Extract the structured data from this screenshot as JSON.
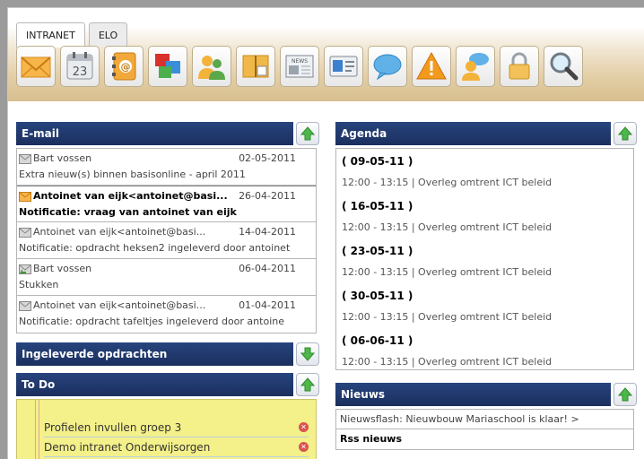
{
  "tabs": [
    {
      "label": "INTRANET",
      "active": true
    },
    {
      "label": "ELO",
      "active": false
    }
  ],
  "toolbar": [
    {
      "icon": "envelope-icon"
    },
    {
      "icon": "calendar-icon",
      "text": "23"
    },
    {
      "icon": "address-book-icon"
    },
    {
      "icon": "windows-icon"
    },
    {
      "icon": "users-icon"
    },
    {
      "icon": "book-icon"
    },
    {
      "icon": "news-icon",
      "text": "NEWS"
    },
    {
      "icon": "id-card-icon"
    },
    {
      "icon": "chat-icon"
    },
    {
      "icon": "warning-icon"
    },
    {
      "icon": "user-chat-icon"
    },
    {
      "icon": "lock-icon"
    },
    {
      "icon": "search-icon"
    }
  ],
  "email": {
    "title": "E-mail",
    "items": [
      {
        "from": "Bart vossen",
        "date": "02-05-2011",
        "subject": "Extra nieuw(s) binnen basisonline - april 2011",
        "unread": false,
        "icon": "read-mail-icon"
      },
      {
        "from": "Antoinet van eijk<antoinet@basi...",
        "date": "26-04-2011",
        "subject": "Notificatie: vraag van antoinet van eijk",
        "unread": true,
        "icon": "unread-mail-icon"
      },
      {
        "from": "Antoinet van eijk<antoinet@basi...",
        "date": "14-04-2011",
        "subject": "Notificatie: opdracht heksen2 ingeleverd door antoinet",
        "unread": false,
        "icon": "read-mail-icon"
      },
      {
        "from": "Bart vossen",
        "date": "06-04-2011",
        "subject": "Stukken",
        "unread": false,
        "icon": "replied-mail-icon"
      },
      {
        "from": "Antoinet van eijk<antoinet@basi...",
        "date": "01-04-2011",
        "subject": "Notificatie: opdracht tafeltjes ingeleverd door antoine",
        "unread": false,
        "icon": "read-mail-icon"
      }
    ]
  },
  "ingeleverd": {
    "title": "Ingeleverde opdrachten"
  },
  "todo": {
    "title": "To Do",
    "items": [
      "Profielen invullen groep 3",
      "Demo intranet Onderwijsorgen"
    ]
  },
  "agenda": {
    "title": "Agenda",
    "items": [
      {
        "date": "( 09-05-11 )",
        "event": "12:00 - 13:15 | Overleg omtrent ICT beleid"
      },
      {
        "date": "( 16-05-11 )",
        "event": "12:00 - 13:15 | Overleg omtrent ICT beleid"
      },
      {
        "date": "( 23-05-11 )",
        "event": "12:00 - 13:15 | Overleg omtrent ICT beleid"
      },
      {
        "date": "( 30-05-11 )",
        "event": "12:00 - 13:15 | Overleg omtrent ICT beleid"
      },
      {
        "date": "( 06-06-11 )",
        "event": "12:00 - 13:15 | Overleg omtrent ICT beleid"
      }
    ]
  },
  "nieuws": {
    "title": "Nieuws",
    "item": "Nieuwsflash: Nieuwbouw Mariaschool is klaar! >",
    "rss": "Rss nieuws"
  },
  "colors": {
    "panel_header": "#1f3568",
    "header_gold": "#e2cda4",
    "todo_bg": "#f4f08a"
  }
}
